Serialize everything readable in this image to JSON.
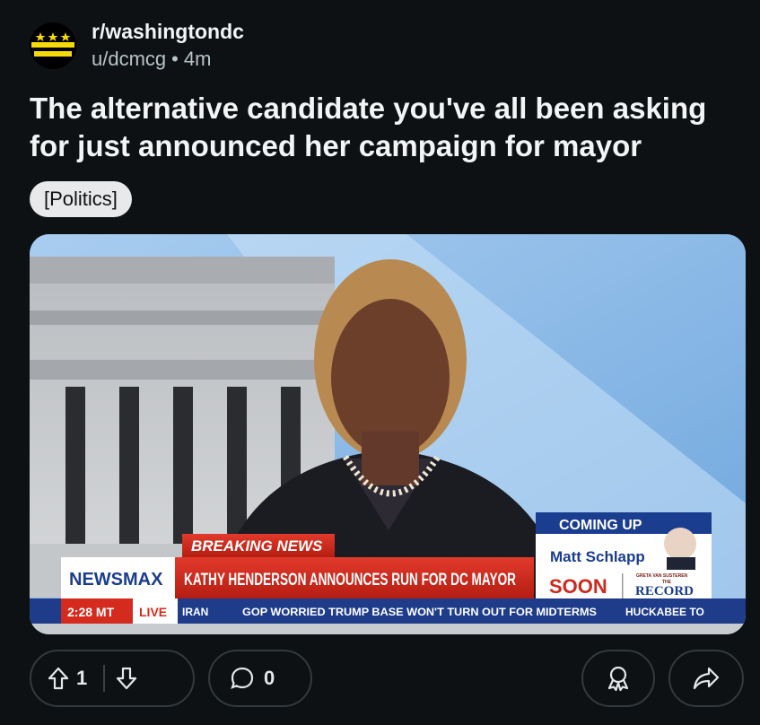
{
  "post": {
    "subreddit": "r/washingtondc",
    "author": "u/dcmcg",
    "separator": "•",
    "age": "4m",
    "title": "The alternative candidate you've all been asking for just announced her campaign for mayor",
    "flair": "[Politics]"
  },
  "media": {
    "breaking_label": "BREAKING NEWS",
    "channel": "NEWSMAX",
    "headline": "KATHY HENDERSON ANNOUNCES RUN FOR DC MAYOR",
    "time": "2:28 MT",
    "live": "LIVE",
    "ticker_items": [
      "IRAN",
      "GOP WORRIED TRUMP BASE WON'T TURN OUT FOR MIDTERMS",
      "HUCKABEE TO"
    ],
    "coming_up_label": "COMING UP",
    "coming_up_name": "Matt Schlapp",
    "soon": "SOON",
    "show_small": "GRETA VAN SUSTEREN",
    "show_the": "THE",
    "show_name": "RECORD"
  },
  "actions": {
    "upvotes": "1",
    "comments": "0"
  },
  "colors": {
    "background": "#0e1113",
    "breaking_red": "#d52b1e",
    "newsmax_blue": "#1a3d8f"
  },
  "icons": [
    "upvote-icon",
    "downvote-icon",
    "comment-icon",
    "award-icon",
    "share-icon"
  ]
}
